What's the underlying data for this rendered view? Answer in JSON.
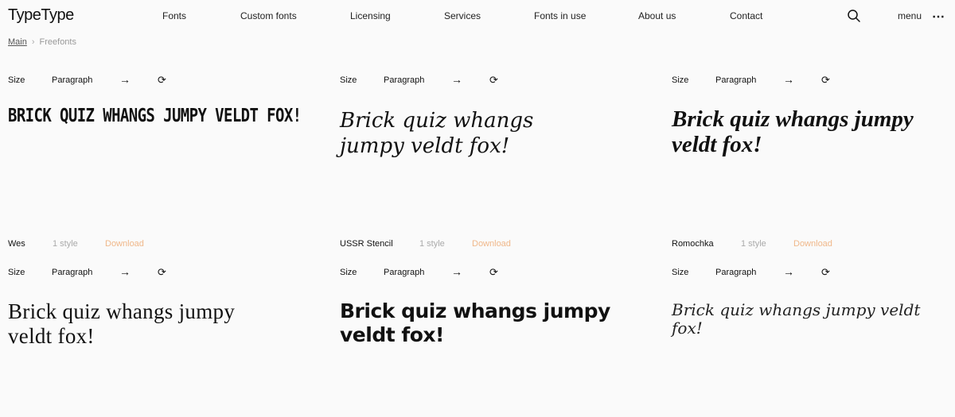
{
  "header": {
    "logo": "TypeType",
    "nav": [
      "Fonts",
      "Custom fonts",
      "Licensing",
      "Services",
      "Fonts in use",
      "About us",
      "Contact"
    ],
    "search_icon": "search-icon",
    "menu_label": "menu",
    "more_icon": "⋯"
  },
  "breadcrumb": {
    "main": "Main",
    "separator": "›",
    "current": "Freefonts"
  },
  "controls": {
    "size": "Size",
    "paragraph": "Paragraph",
    "arrow": "→",
    "refresh": "⟳"
  },
  "sample_text": "Brick quiz whangs jumpy veldt fox!",
  "sample_text_caps": "BRICK QUIZ WHANGS JUMPY VELDT FOX!",
  "fonts": [
    {
      "name": "Wes",
      "styles": "1 style",
      "download": "Download"
    },
    {
      "name": "USSR Stencil",
      "styles": "1 style",
      "download": "Download"
    },
    {
      "name": "Romochka",
      "styles": "1 style",
      "download": "Download"
    }
  ],
  "colors": {
    "accent_download": "#f0b88a",
    "muted": "#aaaaaa",
    "background": "#fafafa"
  }
}
